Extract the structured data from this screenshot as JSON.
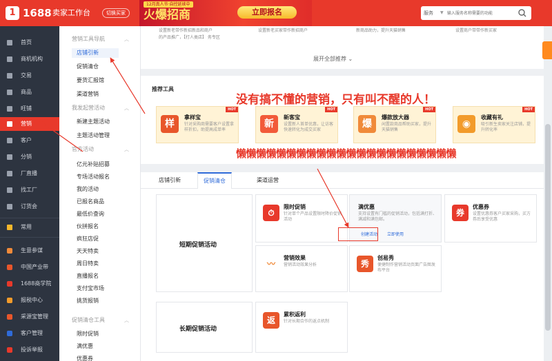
{
  "topbar": {
    "logo": "1",
    "brand": "1688",
    "subtitle": "卖家工作台",
    "switch_label": "切换买家",
    "banner_tag": "12月真人节·自控延续中",
    "banner_title": "火爆招商",
    "banner_btn": "立即报名",
    "search_category": "服务",
    "search_placeholder": "输入服务名称需要的功能"
  },
  "leftnav": {
    "items": [
      {
        "label": "首页"
      },
      {
        "label": "商机机构"
      },
      {
        "label": "交易"
      },
      {
        "label": "商品"
      },
      {
        "label": "旺铺"
      },
      {
        "label": "营销"
      },
      {
        "label": "客户"
      },
      {
        "label": "分销"
      },
      {
        "label": "厂直播"
      },
      {
        "label": "找工厂"
      },
      {
        "label": "订货会"
      },
      {
        "label": "常用"
      },
      {
        "label": "生意参谋"
      },
      {
        "label": "中国产业带"
      },
      {
        "label": "1688商学院"
      },
      {
        "label": "报税中心"
      },
      {
        "label": "采源宝管理"
      },
      {
        "label": "客户管理"
      },
      {
        "label": "投诉举报"
      }
    ],
    "colors": {
      "active": "#e8392b",
      "bg": "#2d3440"
    }
  },
  "subnav": {
    "groups": [
      {
        "title": "营销工具导航",
        "items": [
          "店铺引新",
          "促销清仓",
          "要货汇报馆",
          "渠道营销"
        ]
      },
      {
        "title": "我发起营活动",
        "items": [
          "新建主题活动",
          "主题活动管理"
        ]
      },
      {
        "title": "官方活动",
        "items": [
          "亿元补贴招募",
          "专场活动报名",
          "我的活动",
          "已报名商品",
          "最低价查询",
          "伙拼报名",
          "疯狂店促",
          "天天特卖",
          "周日特卖",
          "直播报名",
          "支付宝市场",
          "挑货报销"
        ]
      },
      {
        "title": "促销清仓工具",
        "items": [
          "限时促销",
          "满优惠",
          "优惠券"
        ]
      }
    ]
  },
  "main": {
    "top_cards": [
      "设置新老带作新招新品和商户",
      "设置新老买家带作新招商户",
      "新商品助力，提升天猫销售",
      "设置商户带带作新买家"
    ],
    "top_card_sub": "的产品推广，【打人类店】 务专区",
    "expand_label": "展开全部推荐",
    "recommend_title": "推荐工具",
    "tools": [
      {
        "icon": "样",
        "name": "拿样宝",
        "desc": "针对采购商需要客户设置拿样折扣，助提高成单率",
        "color": "#e8562b"
      },
      {
        "icon": "新",
        "name": "新客宝",
        "desc": "设置新人首单优惠，让访客快速转化为成交买家",
        "color": "#f25a3a"
      },
      {
        "icon": "爆",
        "name": "爆款放大器",
        "desc": "闲置款商品帮助买家，提升天猫销售",
        "color": "#f08a3a"
      },
      {
        "icon": "◉",
        "name": "收藏有礼",
        "desc": "吸引新生卖家关注店铺，提升转化率",
        "color": "#f29b2b"
      }
    ],
    "hot_label": "HOT",
    "annotation1": "没有搞不懂的营销，只有叫不醒的人！",
    "annotation2": "懒懒懒懒懒懒懒懒懒懒懒懒懒懒懒懒懒懒懒懒懒懒",
    "tabs": [
      "店铺引新",
      "促销清仓",
      "渠道运营"
    ],
    "short_title": "短期促销活动",
    "long_title": "长期促销活动",
    "acts": [
      {
        "icon": "⏱",
        "name": "限时促销",
        "desc": "针对单个产品设置限时降价促销活动",
        "color": "#e8392b"
      },
      {
        "icon": "满",
        "name": "满优惠",
        "desc": "支持设置有门槛的促销活动，包括满打折、满减和满包邮。",
        "color": "#e8392b"
      },
      {
        "icon": "券",
        "name": "优惠券",
        "desc": "设置优惠券客户买家采购，买方券后享受优惠",
        "color": "#e8392b"
      },
      {
        "icon": "〰",
        "name": "营销效果",
        "desc": "营销活动效果分析",
        "color": "#f08a3a"
      },
      {
        "icon": "秀",
        "name": "创易秀",
        "desc": "便捷制作营销活动页面广告图发布平台",
        "color": "#e8562b"
      },
      {
        "icon": "返",
        "name": "累积返利",
        "desc": "针对长期合作的返点机制",
        "color": "#e8562b"
      }
    ],
    "link_create": "创建活动",
    "link_use": "立即使用"
  }
}
